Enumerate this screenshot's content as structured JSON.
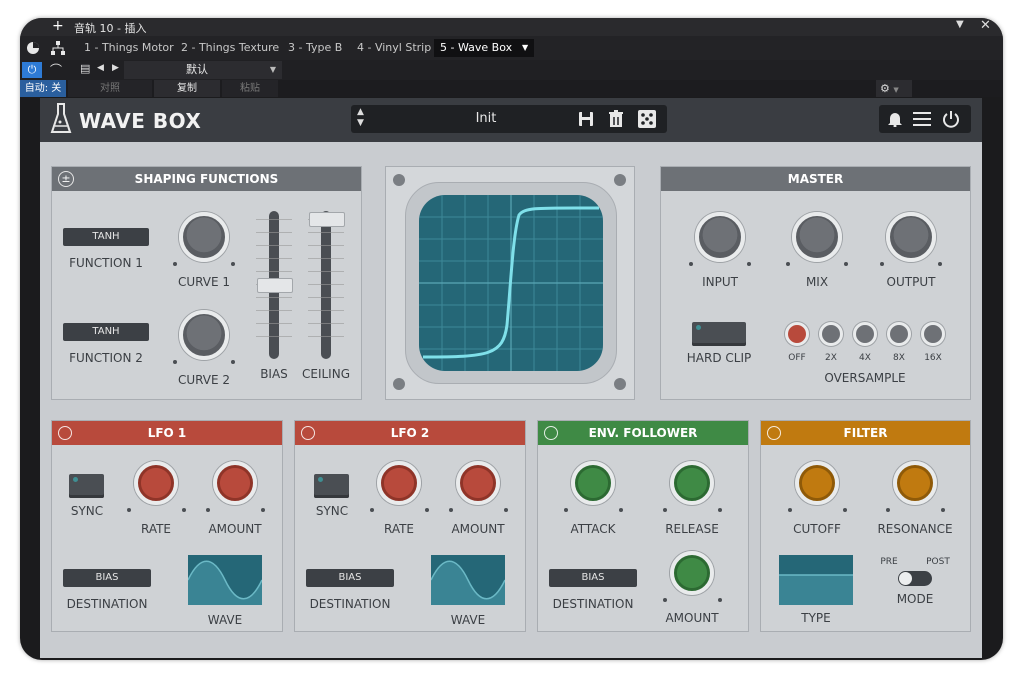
{
  "host": {
    "window_title": "音轨 10 - 插入",
    "tabs": [
      {
        "label": "1 - Things Motor"
      },
      {
        "label": "2 - Things Texture"
      },
      {
        "label": "3 - Type B"
      },
      {
        "label": "4 - Vinyl Strip"
      },
      {
        "label": "5 - Wave Box"
      }
    ],
    "preset_name": "默认",
    "auto_label": "自动: 关",
    "compare_label": "对照",
    "copy_label": "复制",
    "paste_label": "粘贴"
  },
  "plugin": {
    "name": "WAVE BOX",
    "preset": "Init",
    "shaping": {
      "title": "SHAPING FUNCTIONS",
      "function1_value": "TANH",
      "function1_label": "FUNCTION 1",
      "function2_value": "TANH",
      "function2_label": "FUNCTION 2",
      "curve1_label": "CURVE 1",
      "curve2_label": "CURVE 2",
      "bias_label": "BIAS",
      "ceiling_label": "CEILING"
    },
    "master": {
      "title": "MASTER",
      "input_label": "INPUT",
      "mix_label": "MIX",
      "output_label": "OUTPUT",
      "hardclip_label": "HARD CLIP",
      "oversample_label": "OVERSAMPLE",
      "oversample_options": [
        "OFF",
        "2X",
        "4X",
        "8X",
        "16X"
      ],
      "oversample_selected": "OFF"
    },
    "lfo1": {
      "title": "LFO 1",
      "sync_label": "SYNC",
      "rate_label": "RATE",
      "amount_label": "AMOUNT",
      "destination_value": "BIAS",
      "destination_label": "DESTINATION",
      "wave_label": "WAVE"
    },
    "lfo2": {
      "title": "LFO 2",
      "sync_label": "SYNC",
      "rate_label": "RATE",
      "amount_label": "AMOUNT",
      "destination_value": "BIAS",
      "destination_label": "DESTINATION",
      "wave_label": "WAVE"
    },
    "env": {
      "title": "ENV. FOLLOWER",
      "attack_label": "ATTACK",
      "release_label": "RELEASE",
      "destination_value": "BIAS",
      "destination_label": "DESTINATION",
      "amount_label": "AMOUNT"
    },
    "filter": {
      "title": "FILTER",
      "cutoff_label": "CUTOFF",
      "resonance_label": "RESONANCE",
      "type_label": "TYPE",
      "pre_label": "PRE",
      "post_label": "POST",
      "mode_label": "MODE"
    }
  },
  "colors": {
    "lfo_accent": "#b84a3c",
    "env_accent": "#3f8a45",
    "filter_accent": "#c07a10",
    "panel_header": "#6d7176",
    "scope_screen": "#256777",
    "scope_trace": "#7fe0ea"
  }
}
